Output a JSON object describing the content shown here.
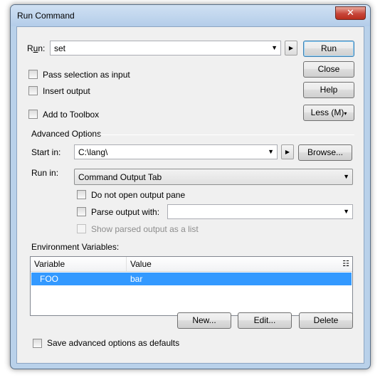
{
  "window": {
    "title": "Run Command",
    "close_glyph": "✕"
  },
  "run": {
    "label_pre": "R",
    "label_ul": "u",
    "label_post": "n:",
    "value": "set"
  },
  "checks": {
    "pass_selection": "Pass selection as input",
    "insert_output": "Insert output",
    "add_to_toolbox": "Add to Toolbox"
  },
  "buttons": {
    "run": "Run",
    "close": "Close",
    "help": "Help",
    "less": "Less (M)",
    "browse": "Browse...",
    "new": "New...",
    "edit": "Edit...",
    "delete": "Delete"
  },
  "advanced": {
    "group_label": "Advanced Options",
    "start_in_label": "Start in:",
    "start_in_value": "C:\\lang\\",
    "run_in_label": "Run in:",
    "run_in_value": "Command Output Tab",
    "do_not_open": "Do not open output pane",
    "parse_output": "Parse output with:",
    "parse_output_value": "",
    "show_parsed": "Show parsed output as a list"
  },
  "env": {
    "label": "Environment Variables:",
    "columns": [
      "Variable",
      "Value"
    ],
    "rows": [
      {
        "variable": "FOO",
        "value": "bar"
      }
    ]
  },
  "save_defaults": "Save advanced options as defaults",
  "icons": {
    "dropdown": "chevron-down-icon",
    "forward": "arrow-right-icon",
    "column_chooser": "column-chooser-icon"
  }
}
